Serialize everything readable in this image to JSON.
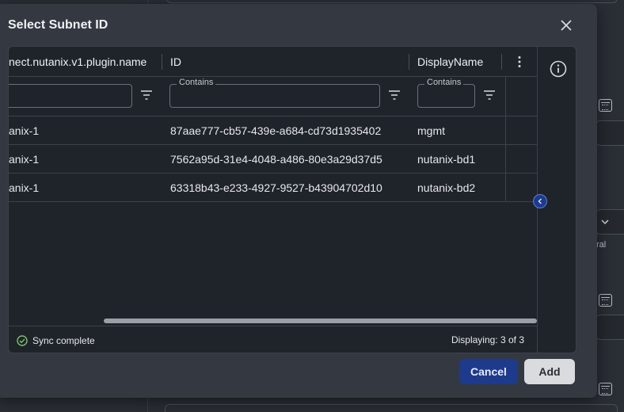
{
  "background": {
    "partial_label": "ral"
  },
  "dialog": {
    "title": "Select Subnet ID",
    "columns": [
      {
        "label": "nect.nutanix.v1.plugin.name"
      },
      {
        "label": "ID"
      },
      {
        "label": "DisplayName"
      }
    ],
    "filters": [
      {
        "legend": "",
        "value": ""
      },
      {
        "legend": "Contains",
        "value": ""
      },
      {
        "legend": "Contains",
        "value": ""
      }
    ],
    "rows": [
      {
        "name": "anix-1",
        "id": "87aae777-cb57-439e-a684-cd73d1935402",
        "display": "mgmt"
      },
      {
        "name": "anix-1",
        "id": "7562a95d-31e4-4048-a486-80e3a29d37d5",
        "display": "nutanix-bd1"
      },
      {
        "name": "anix-1",
        "id": "63318b43-e233-4927-9527-b43904702d10",
        "display": "nutanix-bd2"
      }
    ],
    "status": "Sync complete",
    "count": "Displaying: 3 of 3",
    "cancel_label": "Cancel",
    "add_label": "Add"
  },
  "colors": {
    "primary": "#1e3a8a",
    "success": "#7ac36a"
  },
  "icons": [
    "close-icon",
    "kebab-menu-icon",
    "filter-icon",
    "info-icon",
    "check-circle-icon",
    "chevron-left-icon",
    "calendar-icon"
  ]
}
